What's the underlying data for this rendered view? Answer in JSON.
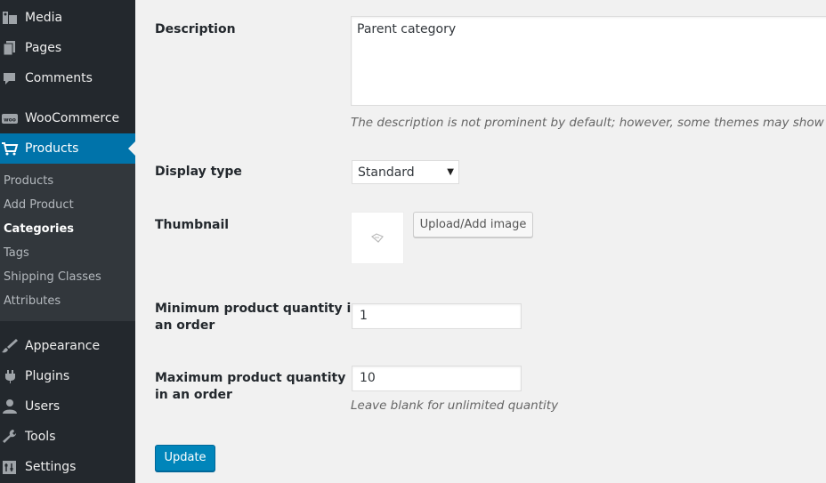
{
  "sidebar": {
    "items": [
      {
        "label": "Media",
        "icon": "media-icon"
      },
      {
        "label": "Pages",
        "icon": "pages-icon"
      },
      {
        "label": "Comments",
        "icon": "comments-icon"
      },
      {
        "label": "WooCommerce",
        "icon": "woocommerce-icon",
        "icon_text": "woo"
      },
      {
        "label": "Products",
        "icon": "cart-icon",
        "active": true
      },
      {
        "label": "Appearance",
        "icon": "paintbrush-icon"
      },
      {
        "label": "Plugins",
        "icon": "plug-icon"
      },
      {
        "label": "Users",
        "icon": "user-icon"
      },
      {
        "label": "Tools",
        "icon": "wrench-icon"
      },
      {
        "label": "Settings",
        "icon": "settings-icon"
      }
    ],
    "submenu": [
      {
        "label": "Products"
      },
      {
        "label": "Add Product"
      },
      {
        "label": "Categories",
        "current": true
      },
      {
        "label": "Tags"
      },
      {
        "label": "Shipping Classes"
      },
      {
        "label": "Attributes"
      }
    ]
  },
  "form": {
    "description": {
      "label": "Description",
      "value": "Parent category",
      "hint": "The description is not prominent by default; however, some themes may show it."
    },
    "display_type": {
      "label": "Display type",
      "value": "Standard"
    },
    "thumbnail": {
      "label": "Thumbnail",
      "button_label": "Upload/Add image"
    },
    "min_qty": {
      "label_line1": "Minimum product quantity in",
      "label_line2": "an order",
      "value": "1"
    },
    "max_qty": {
      "label_line1": "Maximum product quantity",
      "label_line2": "in an order",
      "value": "10",
      "hint": "Leave blank for unlimited quantity"
    },
    "submit_label": "Update"
  },
  "colors": {
    "sidebar_bg": "#23282d",
    "submenu_bg": "#32373c",
    "active_bg": "#0073aa",
    "primary_button": "#0085ba",
    "page_bg": "#f1f1f1"
  }
}
